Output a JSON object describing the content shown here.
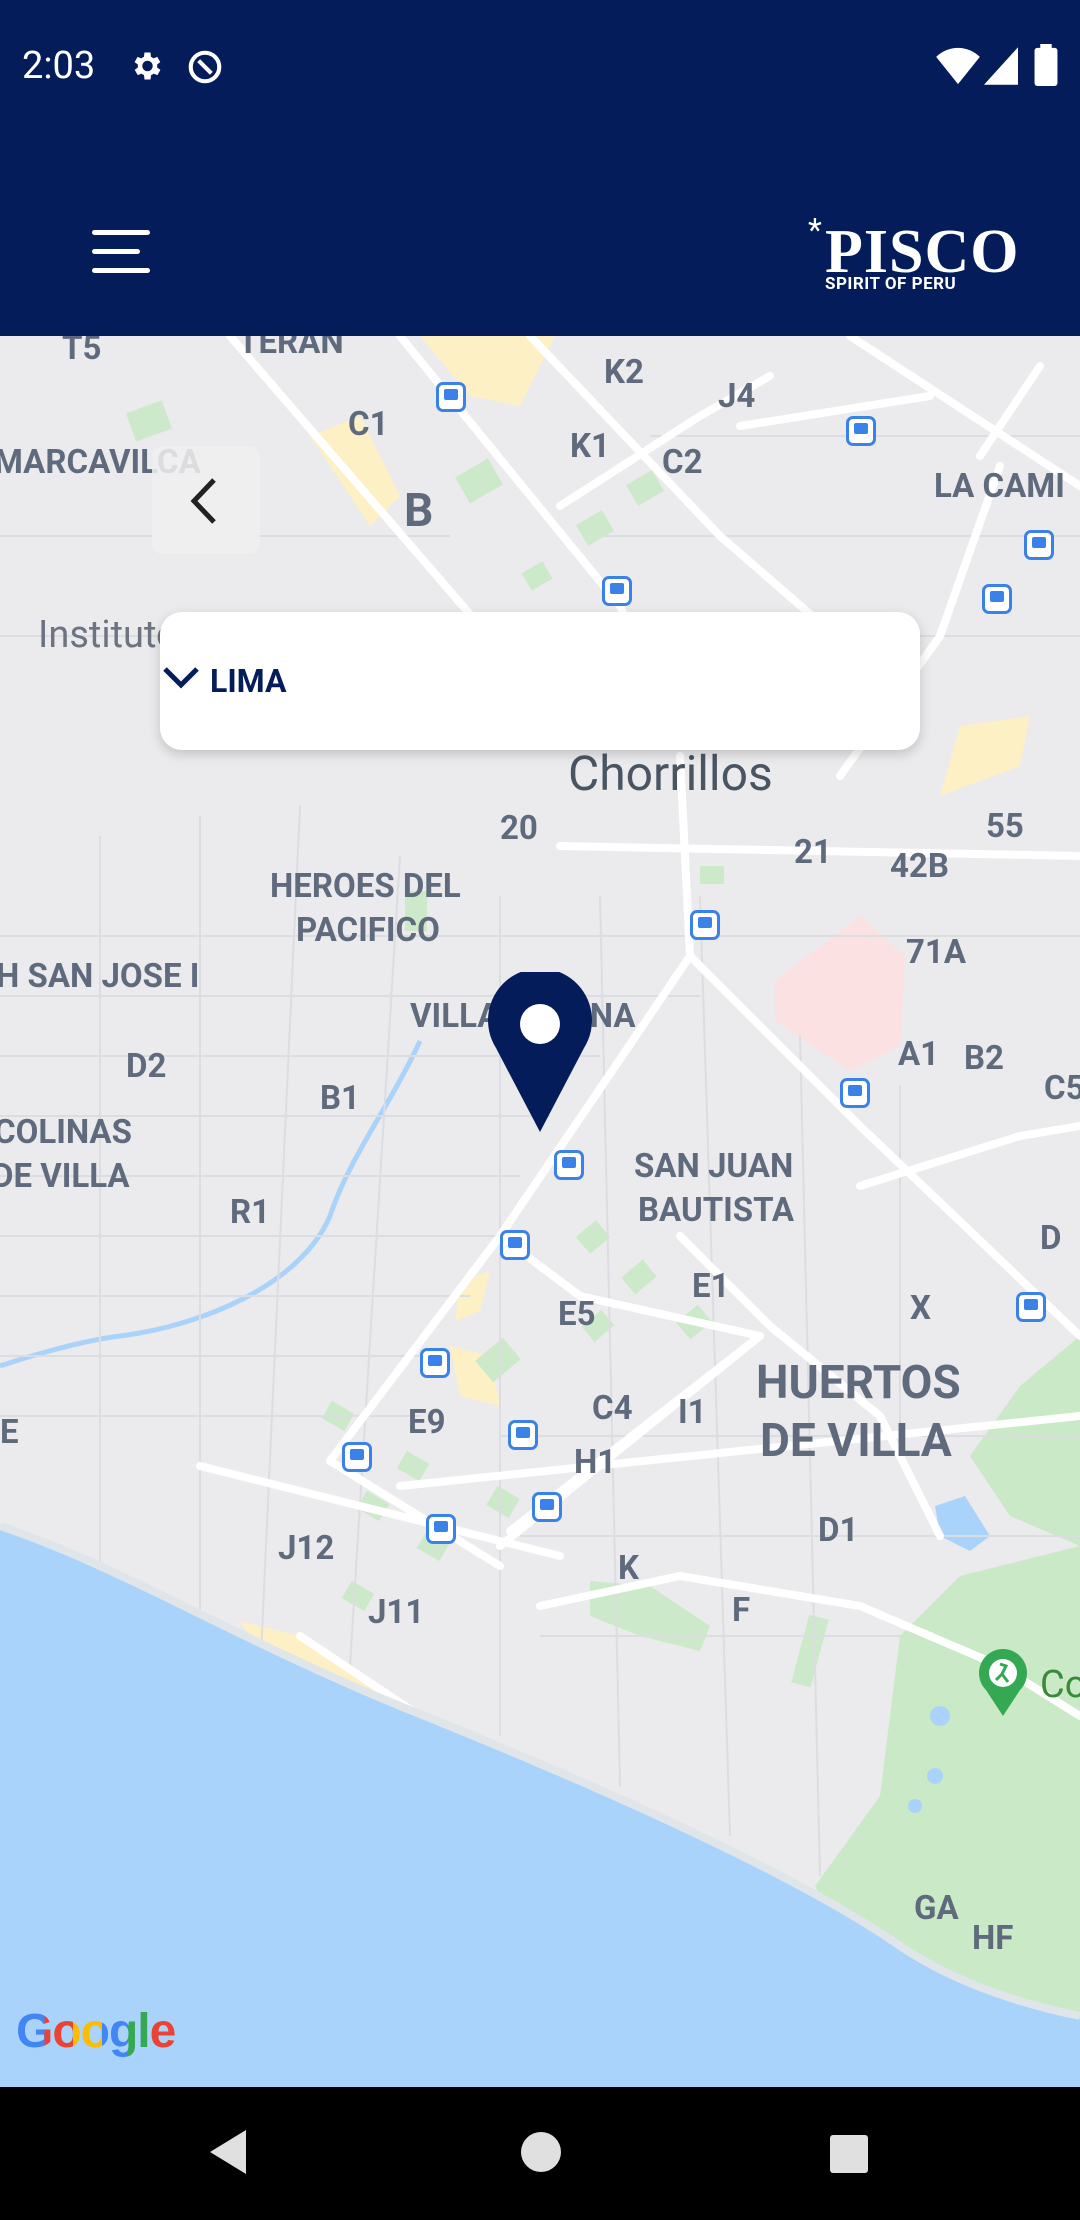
{
  "status_bar": {
    "time": "2:03"
  },
  "header": {
    "logo_text": "PISCO",
    "logo_star": "*",
    "logo_subtitle": "SPIRIT OF PERU"
  },
  "dropdown": {
    "selected": "LIMA"
  },
  "map": {
    "attribution": "Google",
    "labels": [
      {
        "id": "t5",
        "text": "T5"
      },
      {
        "id": "teran",
        "text": "TERAN"
      },
      {
        "id": "k2",
        "text": "K2"
      },
      {
        "id": "j4",
        "text": "J4"
      },
      {
        "id": "c1",
        "text": "C1"
      },
      {
        "id": "k1",
        "text": "K1"
      },
      {
        "id": "c2",
        "text": "C2"
      },
      {
        "id": "marcavilca",
        "text": "MARCAVILCA"
      },
      {
        "id": "b",
        "text": "B"
      },
      {
        "id": "la_cam",
        "text": "LA CAMI"
      },
      {
        "id": "instituto",
        "text": "Instituto"
      },
      {
        "id": "chorrillos",
        "text": "Chorrillos"
      },
      {
        "id": "l20",
        "text": "20"
      },
      {
        "id": "l55",
        "text": "55"
      },
      {
        "id": "l21",
        "text": "21"
      },
      {
        "id": "l42b",
        "text": "42B"
      },
      {
        "id": "heroes1",
        "text": "HEROES DEL"
      },
      {
        "id": "heroes2",
        "text": "PACIFICO"
      },
      {
        "id": "l71a",
        "text": "71A"
      },
      {
        "id": "sanjose",
        "text": "H SAN JOSE I"
      },
      {
        "id": "villamarina",
        "text": "VILLA MARINA"
      },
      {
        "id": "a1",
        "text": "A1"
      },
      {
        "id": "b2",
        "text": "B2"
      },
      {
        "id": "c5",
        "text": "C5"
      },
      {
        "id": "d2",
        "text": "D2"
      },
      {
        "id": "b1",
        "text": "B1"
      },
      {
        "id": "colinas1",
        "text": "COLINAS"
      },
      {
        "id": "colinas2",
        "text": "DE VILLA"
      },
      {
        "id": "sj1",
        "text": "SAN JUAN"
      },
      {
        "id": "sj2",
        "text": "BAUTISTA"
      },
      {
        "id": "r1",
        "text": "R1"
      },
      {
        "id": "d",
        "text": "D"
      },
      {
        "id": "e1",
        "text": "E1"
      },
      {
        "id": "e5",
        "text": "E5"
      },
      {
        "id": "x",
        "text": "X"
      },
      {
        "id": "hv1",
        "text": "HUERTOS"
      },
      {
        "id": "hv2",
        "text": "DE VILLA"
      },
      {
        "id": "e",
        "text": "E"
      },
      {
        "id": "e9",
        "text": "E9"
      },
      {
        "id": "c4",
        "text": "C4"
      },
      {
        "id": "i1",
        "text": "I1"
      },
      {
        "id": "h1",
        "text": "H1"
      },
      {
        "id": "d1",
        "text": "D1"
      },
      {
        "id": "j12",
        "text": "J12"
      },
      {
        "id": "k",
        "text": "K"
      },
      {
        "id": "f",
        "text": "F"
      },
      {
        "id": "j11",
        "text": "J11"
      },
      {
        "id": "co",
        "text": "Co"
      },
      {
        "id": "ga",
        "text": "GA"
      },
      {
        "id": "hf",
        "text": "HF"
      }
    ]
  },
  "colors": {
    "brand_navy": "#041d5a",
    "water": "#aad3fb",
    "park": "#c5e8c5",
    "bus_blue": "#3b82e8"
  }
}
